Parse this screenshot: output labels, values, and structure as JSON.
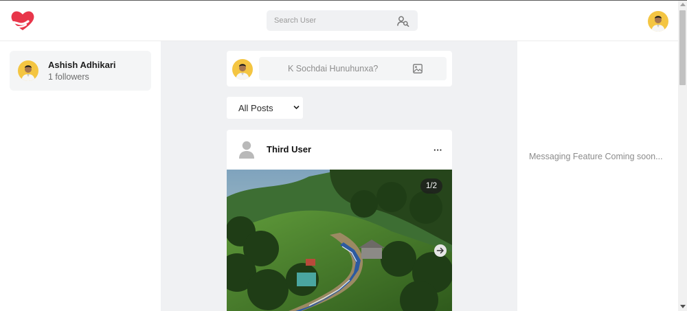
{
  "colors": {
    "brand": "#e8364a",
    "panel_bg": "#f0f1f3",
    "card_bg": "#f4f5f6",
    "avatar_bg": "#f4c542"
  },
  "header": {
    "logo": "heart-hand-icon",
    "search": {
      "placeholder": "Search User",
      "value": "",
      "icon": "user-search-icon"
    },
    "avatar": "user-avatar"
  },
  "sidebar": {
    "profile": {
      "name": "Ashish Adhikari",
      "followers": "1 followers"
    }
  },
  "composer": {
    "placeholder": "K Sochdai Hunuhunxa?",
    "icon": "image-icon"
  },
  "feed": {
    "filter": {
      "selected": "All Posts"
    },
    "posts": [
      {
        "user": "Third User",
        "menu": "···",
        "image_counter": "1/2",
        "next_icon": "arrow-right-icon"
      }
    ]
  },
  "right_panel": {
    "message": "Messaging Feature Coming soon..."
  }
}
